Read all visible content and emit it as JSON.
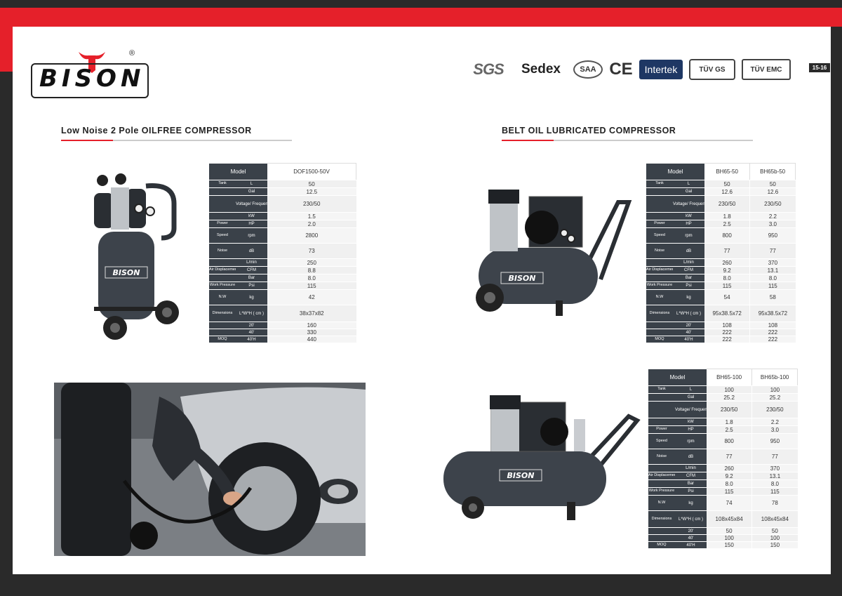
{
  "brand": {
    "logo_text": "BISON",
    "registered": "®"
  },
  "certifications": [
    {
      "name": "SGS",
      "icon": "sgs-logo"
    },
    {
      "name": "Sedex",
      "icon": "sedex-logo"
    },
    {
      "name": "SAA",
      "icon": "saa-logo"
    },
    {
      "name": "CE",
      "icon": "ce-mark"
    },
    {
      "name": "Intertek",
      "icon": "intertek-logo"
    },
    {
      "name": "TÜV GS",
      "icon": "tuv-gs-logo"
    },
    {
      "name": "TÜV EMC",
      "icon": "tuv-emc-logo"
    }
  ],
  "page_number": "15-16",
  "colors": {
    "accent": "#e5202a",
    "dark": "#2a2a2a",
    "table_header": "#3a4149"
  },
  "left_section": {
    "title": "Low Noise 2 Pole OILFREE COMPRESSOR",
    "spec": {
      "header": "Model",
      "models": [
        "DOF1500-50V"
      ],
      "rows": [
        {
          "label": "Tank",
          "unit": "L",
          "values": [
            "50"
          ]
        },
        {
          "label": "",
          "unit": "Gal",
          "values": [
            "12.5"
          ]
        },
        {
          "label": "",
          "unit": "Voltage/ Frequency V/Hz",
          "values": [
            "230/50"
          ]
        },
        {
          "label": "",
          "unit": "kW",
          "values": [
            "1.5"
          ]
        },
        {
          "label": "Power",
          "unit": "HP",
          "values": [
            "2.0"
          ]
        },
        {
          "label": "Speed",
          "unit": "rpm",
          "values": [
            "2800"
          ]
        },
        {
          "label": "Noise",
          "unit": "dB",
          "values": [
            "73"
          ]
        },
        {
          "label": "",
          "unit": "L/min",
          "values": [
            "250"
          ]
        },
        {
          "label": "Air Displacement",
          "unit": "CFM",
          "values": [
            "8.8"
          ]
        },
        {
          "label": "",
          "unit": "Bar",
          "values": [
            "8.0"
          ]
        },
        {
          "label": "Work Pressure",
          "unit": "Psi",
          "values": [
            "115"
          ]
        },
        {
          "label": "N.W",
          "unit": "kg",
          "values": [
            "42"
          ]
        },
        {
          "label": "Dimensions",
          "unit": "L*W*H ( cm )",
          "values": [
            "38x37x82"
          ]
        },
        {
          "label": "",
          "unit": "20'",
          "values": [
            "160"
          ]
        },
        {
          "label": "",
          "unit": "40'",
          "values": [
            "330"
          ]
        },
        {
          "label": "MOQ",
          "unit": "40'H",
          "values": [
            "440"
          ]
        }
      ]
    }
  },
  "right_section": {
    "title": "BELT OIL LUBRICATED COMPRESSOR",
    "spec_a": {
      "header": "Model",
      "models": [
        "BH65-50",
        "BH65b-50"
      ],
      "rows": [
        {
          "label": "Tank",
          "unit": "L",
          "values": [
            "50",
            "50"
          ]
        },
        {
          "label": "",
          "unit": "Gal",
          "values": [
            "12.6",
            "12.6"
          ]
        },
        {
          "label": "",
          "unit": "Voltage/ Frequency V/Hz",
          "values": [
            "230/50",
            "230/50"
          ]
        },
        {
          "label": "",
          "unit": "kW",
          "values": [
            "1.8",
            "2.2"
          ]
        },
        {
          "label": "Power",
          "unit": "HP",
          "values": [
            "2.5",
            "3.0"
          ]
        },
        {
          "label": "Speed",
          "unit": "rpm",
          "values": [
            "800",
            "950"
          ]
        },
        {
          "label": "Noise",
          "unit": "dB",
          "values": [
            "77",
            "77"
          ]
        },
        {
          "label": "",
          "unit": "L/min",
          "values": [
            "260",
            "370"
          ]
        },
        {
          "label": "Air Displacement",
          "unit": "CFM",
          "values": [
            "9.2",
            "13.1"
          ]
        },
        {
          "label": "",
          "unit": "Bar",
          "values": [
            "8.0",
            "8.0"
          ]
        },
        {
          "label": "Work Pressure",
          "unit": "Psi",
          "values": [
            "115",
            "115"
          ]
        },
        {
          "label": "N.W",
          "unit": "kg",
          "values": [
            "54",
            "58"
          ]
        },
        {
          "label": "Dimensions",
          "unit": "L*W*H ( cm )",
          "values": [
            "95x38.5x72",
            "95x38.5x72"
          ]
        },
        {
          "label": "",
          "unit": "20'",
          "values": [
            "108",
            "108"
          ]
        },
        {
          "label": "",
          "unit": "40'",
          "values": [
            "222",
            "222"
          ]
        },
        {
          "label": "MOQ",
          "unit": "40'H",
          "values": [
            "222",
            "222"
          ]
        }
      ]
    },
    "spec_b": {
      "header": "Model",
      "models": [
        "BH65-100",
        "BH65b-100"
      ],
      "rows": [
        {
          "label": "Tank",
          "unit": "L",
          "values": [
            "100",
            "100"
          ]
        },
        {
          "label": "",
          "unit": "Gal",
          "values": [
            "25.2",
            "25.2"
          ]
        },
        {
          "label": "",
          "unit": "Voltage/ Frequency V/Hz",
          "values": [
            "230/50",
            "230/50"
          ]
        },
        {
          "label": "",
          "unit": "kW",
          "values": [
            "1.8",
            "2.2"
          ]
        },
        {
          "label": "Power",
          "unit": "HP",
          "values": [
            "2.5",
            "3.0"
          ]
        },
        {
          "label": "Speed",
          "unit": "rpm",
          "values": [
            "800",
            "950"
          ]
        },
        {
          "label": "Noise",
          "unit": "dB",
          "values": [
            "77",
            "77"
          ]
        },
        {
          "label": "",
          "unit": "L/min",
          "values": [
            "260",
            "370"
          ]
        },
        {
          "label": "Air Displacement",
          "unit": "CFM",
          "values": [
            "9.2",
            "13.1"
          ]
        },
        {
          "label": "",
          "unit": "Bar",
          "values": [
            "8.0",
            "8.0"
          ]
        },
        {
          "label": "Work Pressure",
          "unit": "Psi",
          "values": [
            "115",
            "115"
          ]
        },
        {
          "label": "N.W",
          "unit": "kg",
          "values": [
            "74",
            "78"
          ]
        },
        {
          "label": "Dimensions",
          "unit": "L*W*H ( cm )",
          "values": [
            "108x45x84",
            "108x45x84"
          ]
        },
        {
          "label": "",
          "unit": "20'",
          "values": [
            "50",
            "50"
          ]
        },
        {
          "label": "",
          "unit": "40'",
          "values": [
            "100",
            "100"
          ]
        },
        {
          "label": "MOQ",
          "unit": "40'H",
          "values": [
            "150",
            "150"
          ]
        }
      ]
    }
  },
  "product_logo_text": "BISON"
}
